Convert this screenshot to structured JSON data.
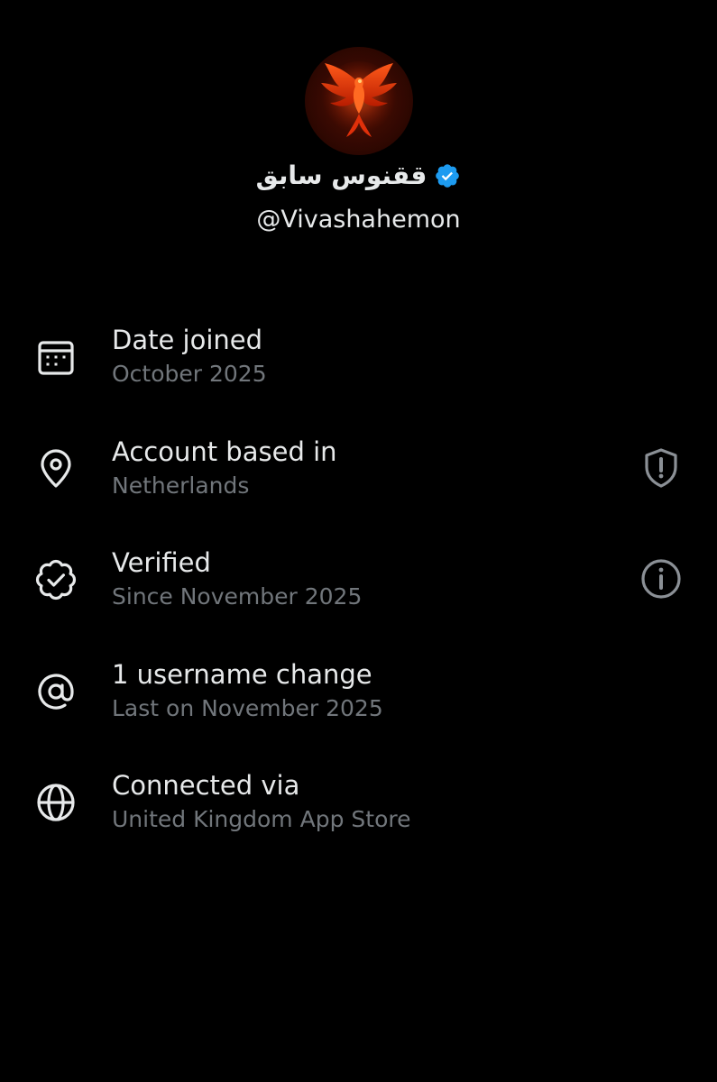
{
  "profile": {
    "display_name": "ققنوس سابق",
    "handle": "@Vivashahemon",
    "verified": true,
    "avatar": "phoenix-avatar",
    "verified_badge_color": "#1d9bf0"
  },
  "about_rows": [
    {
      "icon": "calendar-icon",
      "title": "Date joined",
      "subtitle": "October 2025"
    },
    {
      "icon": "location-pin-icon",
      "title": "Account based in",
      "subtitle": "Netherlands",
      "action_icon": "shield-alert-icon"
    },
    {
      "icon": "verified-badge-outline-icon",
      "title": "Verified",
      "subtitle": "Since November 2025",
      "action_icon": "info-icon"
    },
    {
      "icon": "at-sign-icon",
      "title": "1 username change",
      "subtitle": "Last on November 2025"
    },
    {
      "icon": "globe-icon",
      "title": "Connected via",
      "subtitle": "United Kingdom App Store"
    }
  ],
  "colors": {
    "background": "#000000",
    "primary_text": "#e7e9ea",
    "secondary_text": "#71767b",
    "icon": "#e7e9ea",
    "action_icon": "#8b9096"
  }
}
